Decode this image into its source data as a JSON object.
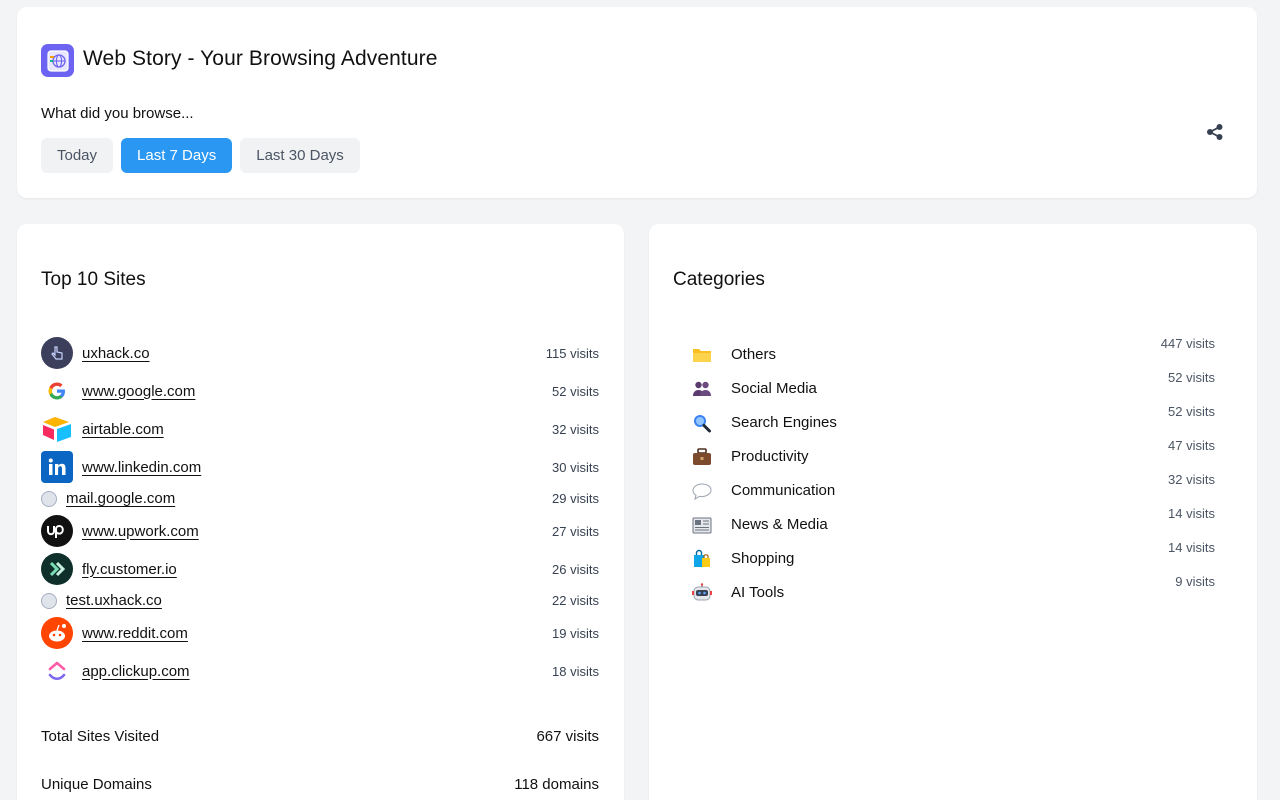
{
  "app": {
    "title": "Web Story - Your Browsing Adventure",
    "accent": "#2a97f3",
    "logo_color": "#6d63f2"
  },
  "filter": {
    "prompt": "What did you browse...",
    "options": [
      "Today",
      "Last 7 Days",
      "Last 30 Days"
    ],
    "selected": "Last 7 Days"
  },
  "share": {
    "icon": "share-icon"
  },
  "top_sites": {
    "title": "Top 10 Sites",
    "items": [
      {
        "domain": "uxhack.co",
        "visits": "115 visits",
        "icon": "uxhack-favicon"
      },
      {
        "domain": "www.google.com",
        "visits": "52 visits",
        "icon": "google-favicon"
      },
      {
        "domain": "airtable.com",
        "visits": "32 visits",
        "icon": "airtable-favicon"
      },
      {
        "domain": "www.linkedin.com",
        "visits": "30 visits",
        "icon": "linkedin-favicon"
      },
      {
        "domain": "mail.google.com",
        "visits": "29 visits",
        "icon": "globe-icon"
      },
      {
        "domain": "www.upwork.com",
        "visits": "27 visits",
        "icon": "upwork-favicon"
      },
      {
        "domain": "fly.customer.io",
        "visits": "26 visits",
        "icon": "customerio-favicon"
      },
      {
        "domain": "test.uxhack.co",
        "visits": "22 visits",
        "icon": "globe-icon"
      },
      {
        "domain": "www.reddit.com",
        "visits": "19 visits",
        "icon": "reddit-favicon"
      },
      {
        "domain": "app.clickup.com",
        "visits": "18 visits",
        "icon": "clickup-favicon"
      }
    ],
    "total_label": "Total Sites Visited",
    "total_value": "667 visits",
    "unique_label": "Unique Domains",
    "unique_value": "118 domains"
  },
  "categories": {
    "title": "Categories",
    "items": [
      {
        "name": "Others",
        "visits": "447 visits",
        "icon": "folder-icon"
      },
      {
        "name": "Social Media",
        "visits": "52 visits",
        "icon": "people-icon"
      },
      {
        "name": "Search Engines",
        "visits": "52 visits",
        "icon": "magnifier-icon"
      },
      {
        "name": "Productivity",
        "visits": "47 visits",
        "icon": "briefcase-icon"
      },
      {
        "name": "Communication",
        "visits": "32 visits",
        "icon": "speech-bubble-icon"
      },
      {
        "name": "News & Media",
        "visits": "14 visits",
        "icon": "newspaper-icon"
      },
      {
        "name": "Shopping",
        "visits": "14 visits",
        "icon": "shopping-bags-icon"
      },
      {
        "name": "AI Tools",
        "visits": "9 visits",
        "icon": "robot-icon"
      }
    ]
  }
}
